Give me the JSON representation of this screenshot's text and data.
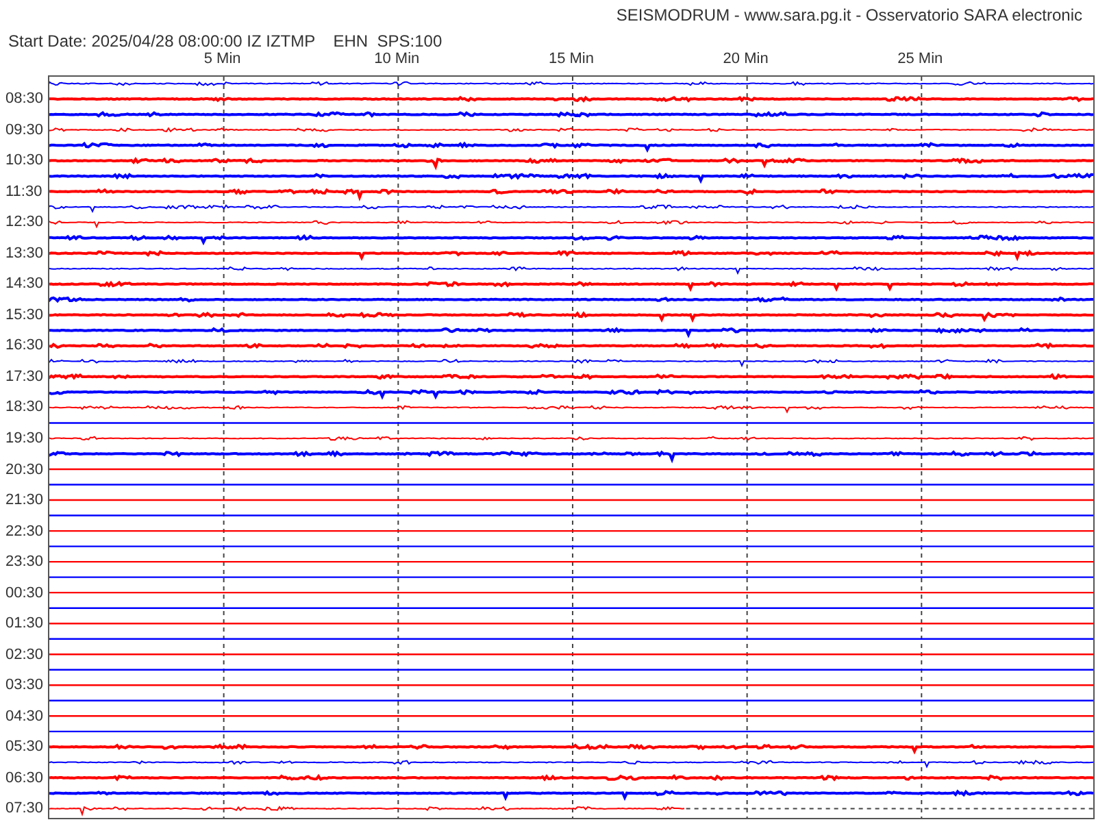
{
  "header": {
    "title": "SEISMODRUM - www.sara.pg.it - Osservatorio SARA electronic",
    "start_date": "Start Date: 2025/04/28 08:00:00 IZ IZTMP    EHN  SPS:100"
  },
  "axis": {
    "ticks": [
      "5 Min",
      "10 Min",
      "15 Min",
      "20 Min",
      "25 Min"
    ]
  },
  "traces": [
    {
      "color": "#0000ff",
      "kind": "signal"
    },
    {
      "label": "08:30",
      "color": "#ff0000",
      "kind": "signal"
    },
    {
      "color": "#0000ff",
      "kind": "signal"
    },
    {
      "label": "09:30",
      "color": "#ff0000",
      "kind": "signal"
    },
    {
      "color": "#0000ff",
      "kind": "signal"
    },
    {
      "label": "10:30",
      "color": "#ff0000",
      "kind": "signal"
    },
    {
      "color": "#0000ff",
      "kind": "signal"
    },
    {
      "label": "11:30",
      "color": "#ff0000",
      "kind": "signal"
    },
    {
      "color": "#0000ff",
      "kind": "signal"
    },
    {
      "label": "12:30",
      "color": "#ff0000",
      "kind": "signal"
    },
    {
      "color": "#0000ff",
      "kind": "signal"
    },
    {
      "label": "13:30",
      "color": "#ff0000",
      "kind": "signal"
    },
    {
      "color": "#0000ff",
      "kind": "signal"
    },
    {
      "label": "14:30",
      "color": "#ff0000",
      "kind": "signal"
    },
    {
      "color": "#0000ff",
      "kind": "signal"
    },
    {
      "label": "15:30",
      "color": "#ff0000",
      "kind": "signal"
    },
    {
      "color": "#0000ff",
      "kind": "signal"
    },
    {
      "label": "16:30",
      "color": "#ff0000",
      "kind": "signal"
    },
    {
      "color": "#0000ff",
      "kind": "signal"
    },
    {
      "label": "17:30",
      "color": "#ff0000",
      "kind": "signal"
    },
    {
      "color": "#0000ff",
      "kind": "signal"
    },
    {
      "label": "18:30",
      "color": "#ff0000",
      "kind": "signal"
    },
    {
      "color": "#0000ff",
      "kind": "flat"
    },
    {
      "label": "19:30",
      "color": "#ff0000",
      "kind": "signal"
    },
    {
      "color": "#0000ff",
      "kind": "signal"
    },
    {
      "label": "20:30",
      "color": "#ff0000",
      "kind": "flat"
    },
    {
      "color": "#0000ff",
      "kind": "flat"
    },
    {
      "label": "21:30",
      "color": "#ff0000",
      "kind": "flat"
    },
    {
      "color": "#0000ff",
      "kind": "flat"
    },
    {
      "label": "22:30",
      "color": "#ff0000",
      "kind": "flat"
    },
    {
      "color": "#0000ff",
      "kind": "flat"
    },
    {
      "label": "23:30",
      "color": "#ff0000",
      "kind": "flat"
    },
    {
      "color": "#0000ff",
      "kind": "flat"
    },
    {
      "label": "00:30",
      "color": "#ff0000",
      "kind": "flat"
    },
    {
      "color": "#0000ff",
      "kind": "flat"
    },
    {
      "label": "01:30",
      "color": "#ff0000",
      "kind": "flat"
    },
    {
      "color": "#0000ff",
      "kind": "flat"
    },
    {
      "label": "02:30",
      "color": "#ff0000",
      "kind": "flat"
    },
    {
      "color": "#0000ff",
      "kind": "flat"
    },
    {
      "label": "03:30",
      "color": "#ff0000",
      "kind": "flat"
    },
    {
      "color": "#0000ff",
      "kind": "flat"
    },
    {
      "label": "04:30",
      "color": "#ff0000",
      "kind": "flat"
    },
    {
      "color": "#0000ff",
      "kind": "flat"
    },
    {
      "label": "05:30",
      "color": "#ff0000",
      "kind": "signal"
    },
    {
      "color": "#0000ff",
      "kind": "signal"
    },
    {
      "label": "06:30",
      "color": "#ff0000",
      "kind": "signal"
    },
    {
      "color": "#0000ff",
      "kind": "signal"
    },
    {
      "label": "07:30",
      "color": "#ff0000",
      "kind": "signal",
      "level": 0.61
    }
  ]
}
